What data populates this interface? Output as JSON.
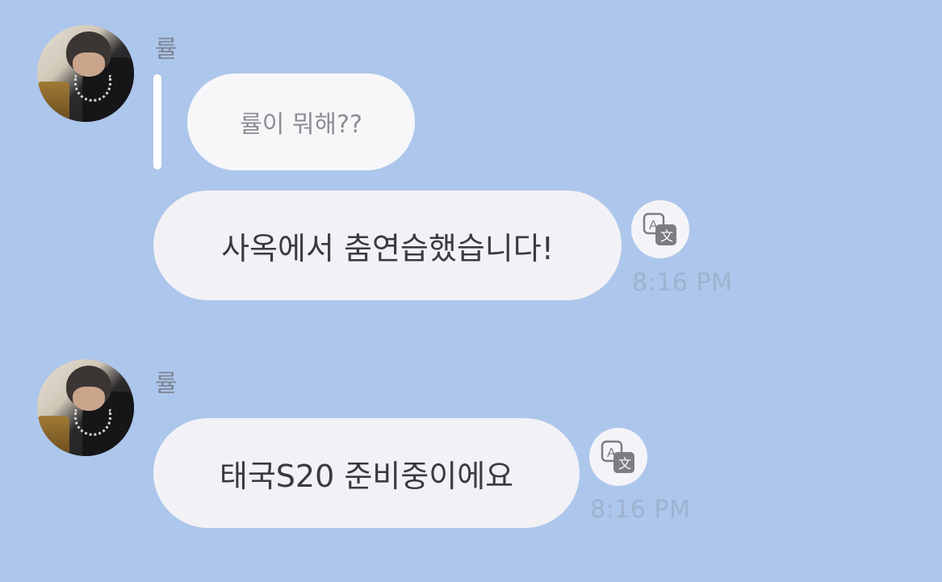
{
  "messages": [
    {
      "sender": "률",
      "reply_quote": "률이 뭐해??",
      "text": "사옥에서 춤연습했습니다!",
      "time": "8:16 PM",
      "translate_icon": "translate-icon"
    },
    {
      "sender": "률",
      "text": "태국S20 준비중이에요",
      "time": "8:16 PM",
      "translate_icon": "translate-icon"
    }
  ],
  "colors": {
    "background": "#adc6eb",
    "bubble": "#f2f2f6",
    "quote_bar": "#ffffff",
    "sender_text": "#7c8594",
    "time_text": "#9eb2cf"
  }
}
